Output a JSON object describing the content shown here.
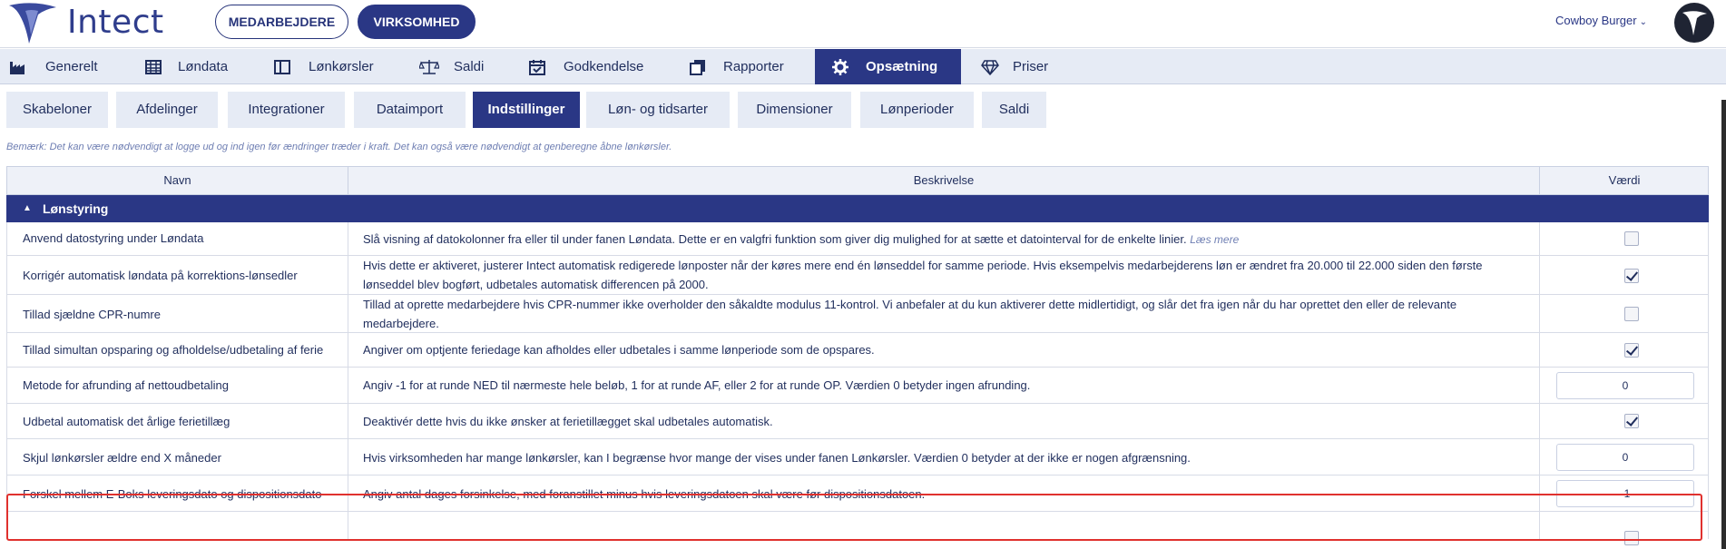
{
  "header": {
    "logo_text": "Intect",
    "toggle": {
      "left": "MEDARBEJDERE",
      "right": "VIRKSOMHED"
    },
    "company": "Cowboy Burger"
  },
  "mainnav": [
    {
      "label": "Generelt",
      "icon": "factory-icon"
    },
    {
      "label": "Løndata",
      "icon": "grid-icon"
    },
    {
      "label": "Lønkørsler",
      "icon": "book-icon"
    },
    {
      "label": "Saldi",
      "icon": "scale-icon"
    },
    {
      "label": "Godkendelse",
      "icon": "calendar-check-icon"
    },
    {
      "label": "Rapporter",
      "icon": "copy-icon"
    },
    {
      "label": "Opsætning",
      "icon": "gear-icon"
    },
    {
      "label": "Priser",
      "icon": "diamond-icon"
    }
  ],
  "subtabs": [
    "Skabeloner",
    "Afdelinger",
    "Integrationer",
    "Dataimport",
    "Indstillinger",
    "Løn- og tidsarter",
    "Dimensioner",
    "Lønperioder",
    "Saldi"
  ],
  "note": "Bemærk: Det kan være nødvendigt at logge ud og ind igen før ændringer træder i kraft. Det kan også være nødvendigt at genberegne åbne lønkørsler.",
  "table": {
    "headers": {
      "name": "Navn",
      "description": "Beskrivelse",
      "value": "Værdi"
    },
    "group": "Lønstyring",
    "rows": [
      {
        "name": "Anvend datostyring under Løndata",
        "description": "Slå visning af datokolonner fra eller til under fanen Løndata. Dette er en valgfri funktion som giver dig mulighed for at sætte et datointerval for de enkelte linier.",
        "link": "Læs mere",
        "type": "checkbox",
        "value": false
      },
      {
        "name": "Korrigér automatisk løndata på korrektions-lønsedler",
        "description": "Hvis dette er aktiveret, justerer Intect automatisk redigerede lønposter når der køres mere end én lønseddel for samme periode. Hvis eksempelvis medarbejderens løn er ændret fra 20.000 til 22.000 siden den første lønseddel blev bogført, udbetales automatisk differencen på 2000.",
        "type": "checkbox",
        "value": true
      },
      {
        "name": "Tillad sjældne CPR-numre",
        "description": "Tillad at oprette medarbejdere hvis CPR-nummer ikke overholder den såkaldte modulus 11-kontrol. Vi anbefaler at du kun aktiverer dette midlertidigt, og slår det fra igen når du har oprettet den eller de relevante medarbejdere.",
        "type": "checkbox",
        "value": false
      },
      {
        "name": "Tillad simultan opsparing og afholdelse/udbetaling af ferie",
        "description": "Angiver om optjente feriedage kan afholdes eller udbetales i samme lønperiode som de opspares.",
        "type": "checkbox",
        "value": true
      },
      {
        "name": "Metode for afrunding af nettoudbetaling",
        "description": "Angiv -1 for at runde NED til nærmeste hele beløb, 1 for at runde AF, eller 2 for at runde OP. Værdien 0 betyder ingen afrunding.",
        "type": "number",
        "value": "0"
      },
      {
        "name": "Udbetal automatisk det årlige ferietillæg",
        "description": "Deaktivér dette hvis du ikke ønsker at ferietillægget skal udbetales automatisk.",
        "type": "checkbox",
        "value": true
      },
      {
        "name": "Skjul lønkørsler ældre end X måneder",
        "description": "Hvis virksomheden har mange lønkørsler, kan I begrænse hvor mange der vises under fanen Lønkørsler. Værdien 0 betyder at der ikke er nogen afgrænsning.",
        "type": "number",
        "value": "0"
      },
      {
        "name": "Forskel mellem E-Boks leveringsdato og dispositionsdato",
        "description": "Angiv antal dages forsinkelse, med foranstillet minus hvis leveringsdatoen skal være før dispositionsdatoen.",
        "type": "number",
        "value": "-1"
      }
    ]
  },
  "colors": {
    "primary": "#2a3785",
    "nav_bg": "#e6ebf5",
    "highlight": "#e0312e"
  }
}
